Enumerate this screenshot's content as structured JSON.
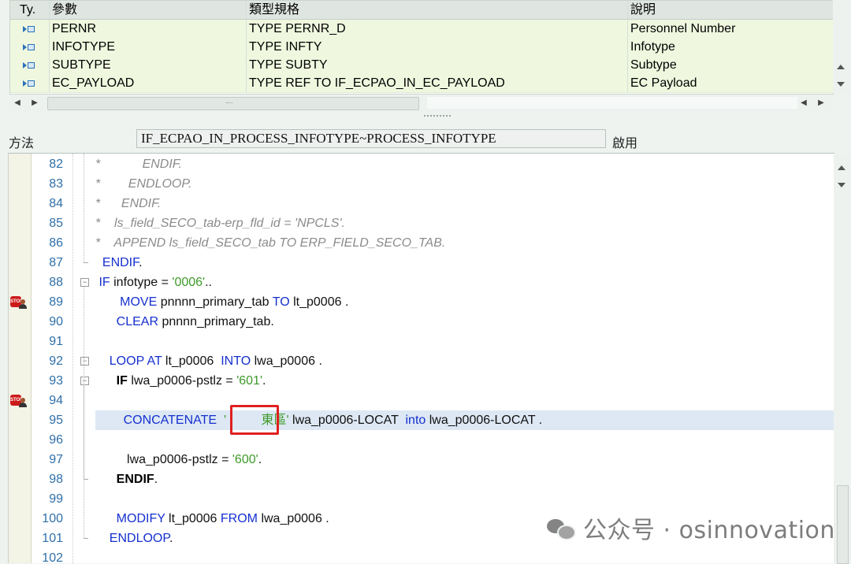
{
  "params": {
    "headers": {
      "ty": "Ty.",
      "param": "參數",
      "type": "類型規格",
      "desc": "說明"
    },
    "rows": [
      {
        "param": "PERNR",
        "type": "TYPE PERNR_D",
        "desc": "Personnel Number"
      },
      {
        "param": "INFOTYPE",
        "type": "TYPE INFTY",
        "desc": "Infotype"
      },
      {
        "param": "SUBTYPE",
        "type": "TYPE SUBTY",
        "desc": "Subtype"
      },
      {
        "param": "EC_PAYLOAD",
        "type": "TYPE REF TO IF_ECPAO_IN_EC_PAYLOAD",
        "desc": "EC Payload"
      }
    ]
  },
  "method": {
    "label": "方法",
    "name": "IF_ECPAO_IN_PROCESS_INFOTYPE~PROCESS_INFOTYPE",
    "status": "啟用"
  },
  "code": {
    "current_line": "95",
    "lines": [
      {
        "n": "82",
        "parts": [
          {
            "t": "*            ENDIF.",
            "c": "cmt"
          }
        ]
      },
      {
        "n": "83",
        "parts": [
          {
            "t": "*        ENDLOOP.",
            "c": "cmt"
          }
        ]
      },
      {
        "n": "84",
        "parts": [
          {
            "t": "*      ENDIF.",
            "c": "cmt"
          }
        ]
      },
      {
        "n": "85",
        "parts": [
          {
            "t": "*    ls_field_SECO_tab-erp_fld_id = 'NPCLS'.",
            "c": "cmt"
          }
        ]
      },
      {
        "n": "86",
        "parts": [
          {
            "t": "*    APPEND ls_field_SECO_tab TO ERP_FIELD_SECO_TAB.",
            "c": "cmt"
          }
        ]
      },
      {
        "n": "87",
        "parts": [
          {
            "t": "  ",
            "c": ""
          },
          {
            "t": "ENDIF",
            "c": "kw"
          },
          {
            "t": ".",
            "c": ""
          }
        ]
      },
      {
        "n": "88",
        "parts": [
          {
            "t": " ",
            "c": ""
          },
          {
            "t": "IF",
            "c": "kw"
          },
          {
            "t": " infotype = ",
            "c": ""
          },
          {
            "t": "'0006'",
            "c": "str"
          },
          {
            "t": "..",
            "c": ""
          }
        ]
      },
      {
        "n": "89",
        "parts": [
          {
            "t": "       ",
            "c": ""
          },
          {
            "t": "MOVE",
            "c": "kw"
          },
          {
            "t": " pnnnn_primary_tab ",
            "c": ""
          },
          {
            "t": "TO",
            "c": "kw"
          },
          {
            "t": " lt_p0006 .",
            "c": ""
          }
        ]
      },
      {
        "n": "90",
        "parts": [
          {
            "t": "      ",
            "c": ""
          },
          {
            "t": "CLEAR",
            "c": "kw"
          },
          {
            "t": " pnnnn_primary_tab.",
            "c": ""
          }
        ]
      },
      {
        "n": "91",
        "parts": []
      },
      {
        "n": "92",
        "parts": [
          {
            "t": "    ",
            "c": ""
          },
          {
            "t": "LOOP AT",
            "c": "kw"
          },
          {
            "t": " lt_p0006  ",
            "c": ""
          },
          {
            "t": "INTO",
            "c": "kw"
          },
          {
            "t": " lwa_p0006 .",
            "c": ""
          }
        ]
      },
      {
        "n": "93",
        "parts": [
          {
            "t": "      ",
            "c": ""
          },
          {
            "t": "IF",
            "c": "bold"
          },
          {
            "t": " lwa_p0006-pstlz = ",
            "c": ""
          },
          {
            "t": "'601'",
            "c": "str"
          },
          {
            "t": ".",
            "c": ""
          }
        ]
      },
      {
        "n": "94",
        "parts": []
      },
      {
        "n": "95",
        "parts": [
          {
            "t": "        ",
            "c": ""
          },
          {
            "t": "CONCATENATE",
            "c": "kw"
          },
          {
            "t": "  ",
            "c": ""
          },
          {
            "t": "'          東區'",
            "c": "str"
          },
          {
            "t": " lwa_p0006-LOCAT  ",
            "c": ""
          },
          {
            "t": "into",
            "c": "kw"
          },
          {
            "t": " lwa_p0006-LOCAT .",
            "c": ""
          }
        ]
      },
      {
        "n": "96",
        "parts": []
      },
      {
        "n": "97",
        "parts": [
          {
            "t": "         lwa_p0006-pstlz = ",
            "c": ""
          },
          {
            "t": "'600'",
            "c": "str"
          },
          {
            "t": ".",
            "c": ""
          }
        ]
      },
      {
        "n": "98",
        "parts": [
          {
            "t": "      ",
            "c": ""
          },
          {
            "t": "ENDIF",
            "c": "bold"
          },
          {
            "t": ".",
            "c": ""
          }
        ]
      },
      {
        "n": "99",
        "parts": []
      },
      {
        "n": "100",
        "parts": [
          {
            "t": "      ",
            "c": ""
          },
          {
            "t": "MODIFY",
            "c": "kw"
          },
          {
            "t": " lt_p0006 ",
            "c": ""
          },
          {
            "t": "FROM",
            "c": "kw"
          },
          {
            "t": " lwa_p0006 .",
            "c": ""
          }
        ]
      },
      {
        "n": "101",
        "parts": [
          {
            "t": "    ",
            "c": ""
          },
          {
            "t": "ENDLOOP",
            "c": "kw"
          },
          {
            "t": ".",
            "c": ""
          }
        ]
      },
      {
        "n": "102",
        "parts": []
      }
    ],
    "breakpoint_lines": [
      "89",
      "94"
    ],
    "breakpoint_icon_text": "STOP",
    "fold_lines": [
      "88",
      "92",
      "93"
    ]
  },
  "watermark": {
    "text": "公众号 · osinnovation"
  },
  "icons": {
    "param_type": "importing-parameter-icon",
    "breakpoint": "session-breakpoint-icon",
    "fold": "fold-collapse-icon"
  },
  "colors": {
    "keyword": "#1530d0",
    "string": "#3e9a2a",
    "comment": "#8b8b8b",
    "current_line": "#dde8f4",
    "highlight": "#e02020"
  }
}
